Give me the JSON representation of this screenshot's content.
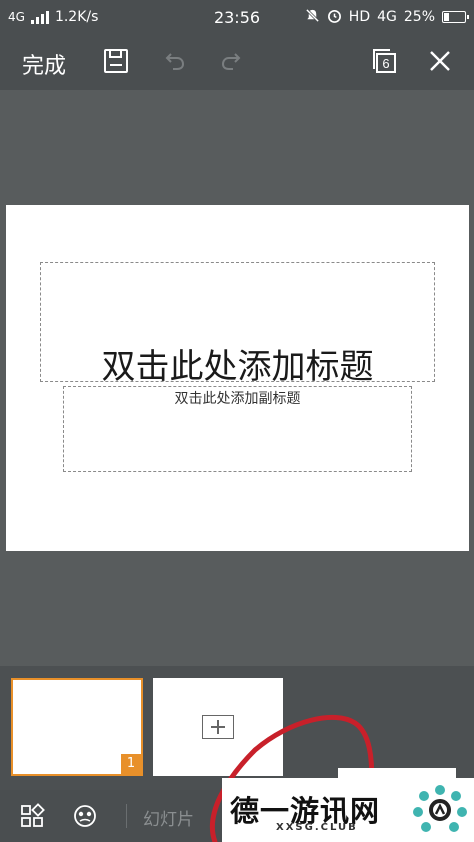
{
  "status_bar": {
    "network": "4G",
    "speed": "1.2K/s",
    "time": "23:56",
    "hd": "HD",
    "network_right": "4G",
    "battery_text": "25%",
    "battery_level": 0.25
  },
  "toolbar": {
    "done_label": "完成",
    "slide_count": "6",
    "icons": [
      "save-icon",
      "undo-icon",
      "redo-icon",
      "slides-count-icon",
      "close-icon"
    ]
  },
  "slide": {
    "title_placeholder": "双击此处添加标题",
    "subtitle_placeholder": "双击此处添加副标题"
  },
  "thumbnails": {
    "items": [
      {
        "number": "1",
        "selected": true
      }
    ],
    "add_icon": "add-slide-icon"
  },
  "bottom_bar": {
    "icons": [
      "grid-icon",
      "face-icon"
    ],
    "label": "幻灯片"
  },
  "watermark": {
    "text": "德一游讯网",
    "url": "XXSG.CLUB"
  },
  "colors": {
    "accent": "#e8902a",
    "background": "#585c5d",
    "bar": "#4a4e50",
    "annotation": "#c8202a"
  }
}
